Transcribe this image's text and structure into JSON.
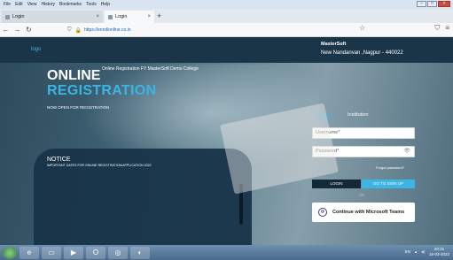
{
  "browser": {
    "menu": [
      "File",
      "Edit",
      "View",
      "History",
      "Bookmarks",
      "Tools",
      "Help"
    ],
    "tabs": [
      {
        "title": "Login",
        "close": "×"
      },
      {
        "title": "Login",
        "close": "×"
      }
    ],
    "new_tab": "+",
    "url": "https://enrollonline.co.in"
  },
  "header": {
    "logo": "logo",
    "org_name": "MasterSoft",
    "org_address": "New Nandanvan ,Nagpur - 440022"
  },
  "hero": {
    "title_line1": "ONLINE",
    "subtitle": "Online Registration FY MasterSoft Demo College",
    "title_line2": "REGISTRATION",
    "open_text": "NOW OPEN FOR REGISTRATION"
  },
  "notice": {
    "title": "NOTICE",
    "text": "IMPORTANT DATES FOR ONLINE REGISTRATION/APPLICATION 2022"
  },
  "login": {
    "tabs": [
      "Student",
      "Institution"
    ],
    "username_placeholder": "Username*",
    "password_placeholder": "Password*",
    "forgot": "Forgot password?",
    "login_button": "LOGIN",
    "signup_button": "GO TO SIGN UP",
    "or": "OR",
    "ms_button": "Continue with Microsoft Teams"
  },
  "taskbar": {
    "time": "20:31",
    "date": "16-03-2022",
    "tray": "EN"
  },
  "colors": {
    "accent": "#3ab5e6",
    "header_bg": "#1b3548",
    "notice_bg": "#183449"
  }
}
